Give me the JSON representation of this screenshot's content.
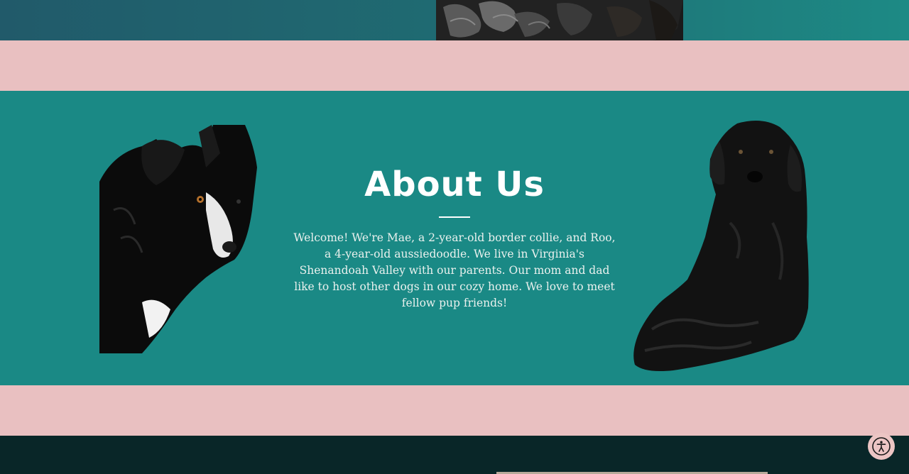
{
  "about": {
    "title": "About Us",
    "body": "Welcome! We're Mae, a 2-year-old border collie, and Roo, a 4-year-old aussiedoodle. We live in Virginia's Shenandoah Valley with our parents. Our mom and dad like to host other dogs in our cozy home. We love to meet fellow pup friends!"
  },
  "icons": {
    "accessibility": "accessibility-icon"
  },
  "colors": {
    "teal": "#1a8985",
    "pink": "#e9c0c1",
    "dark": "#092628",
    "text": "#ffffff"
  }
}
